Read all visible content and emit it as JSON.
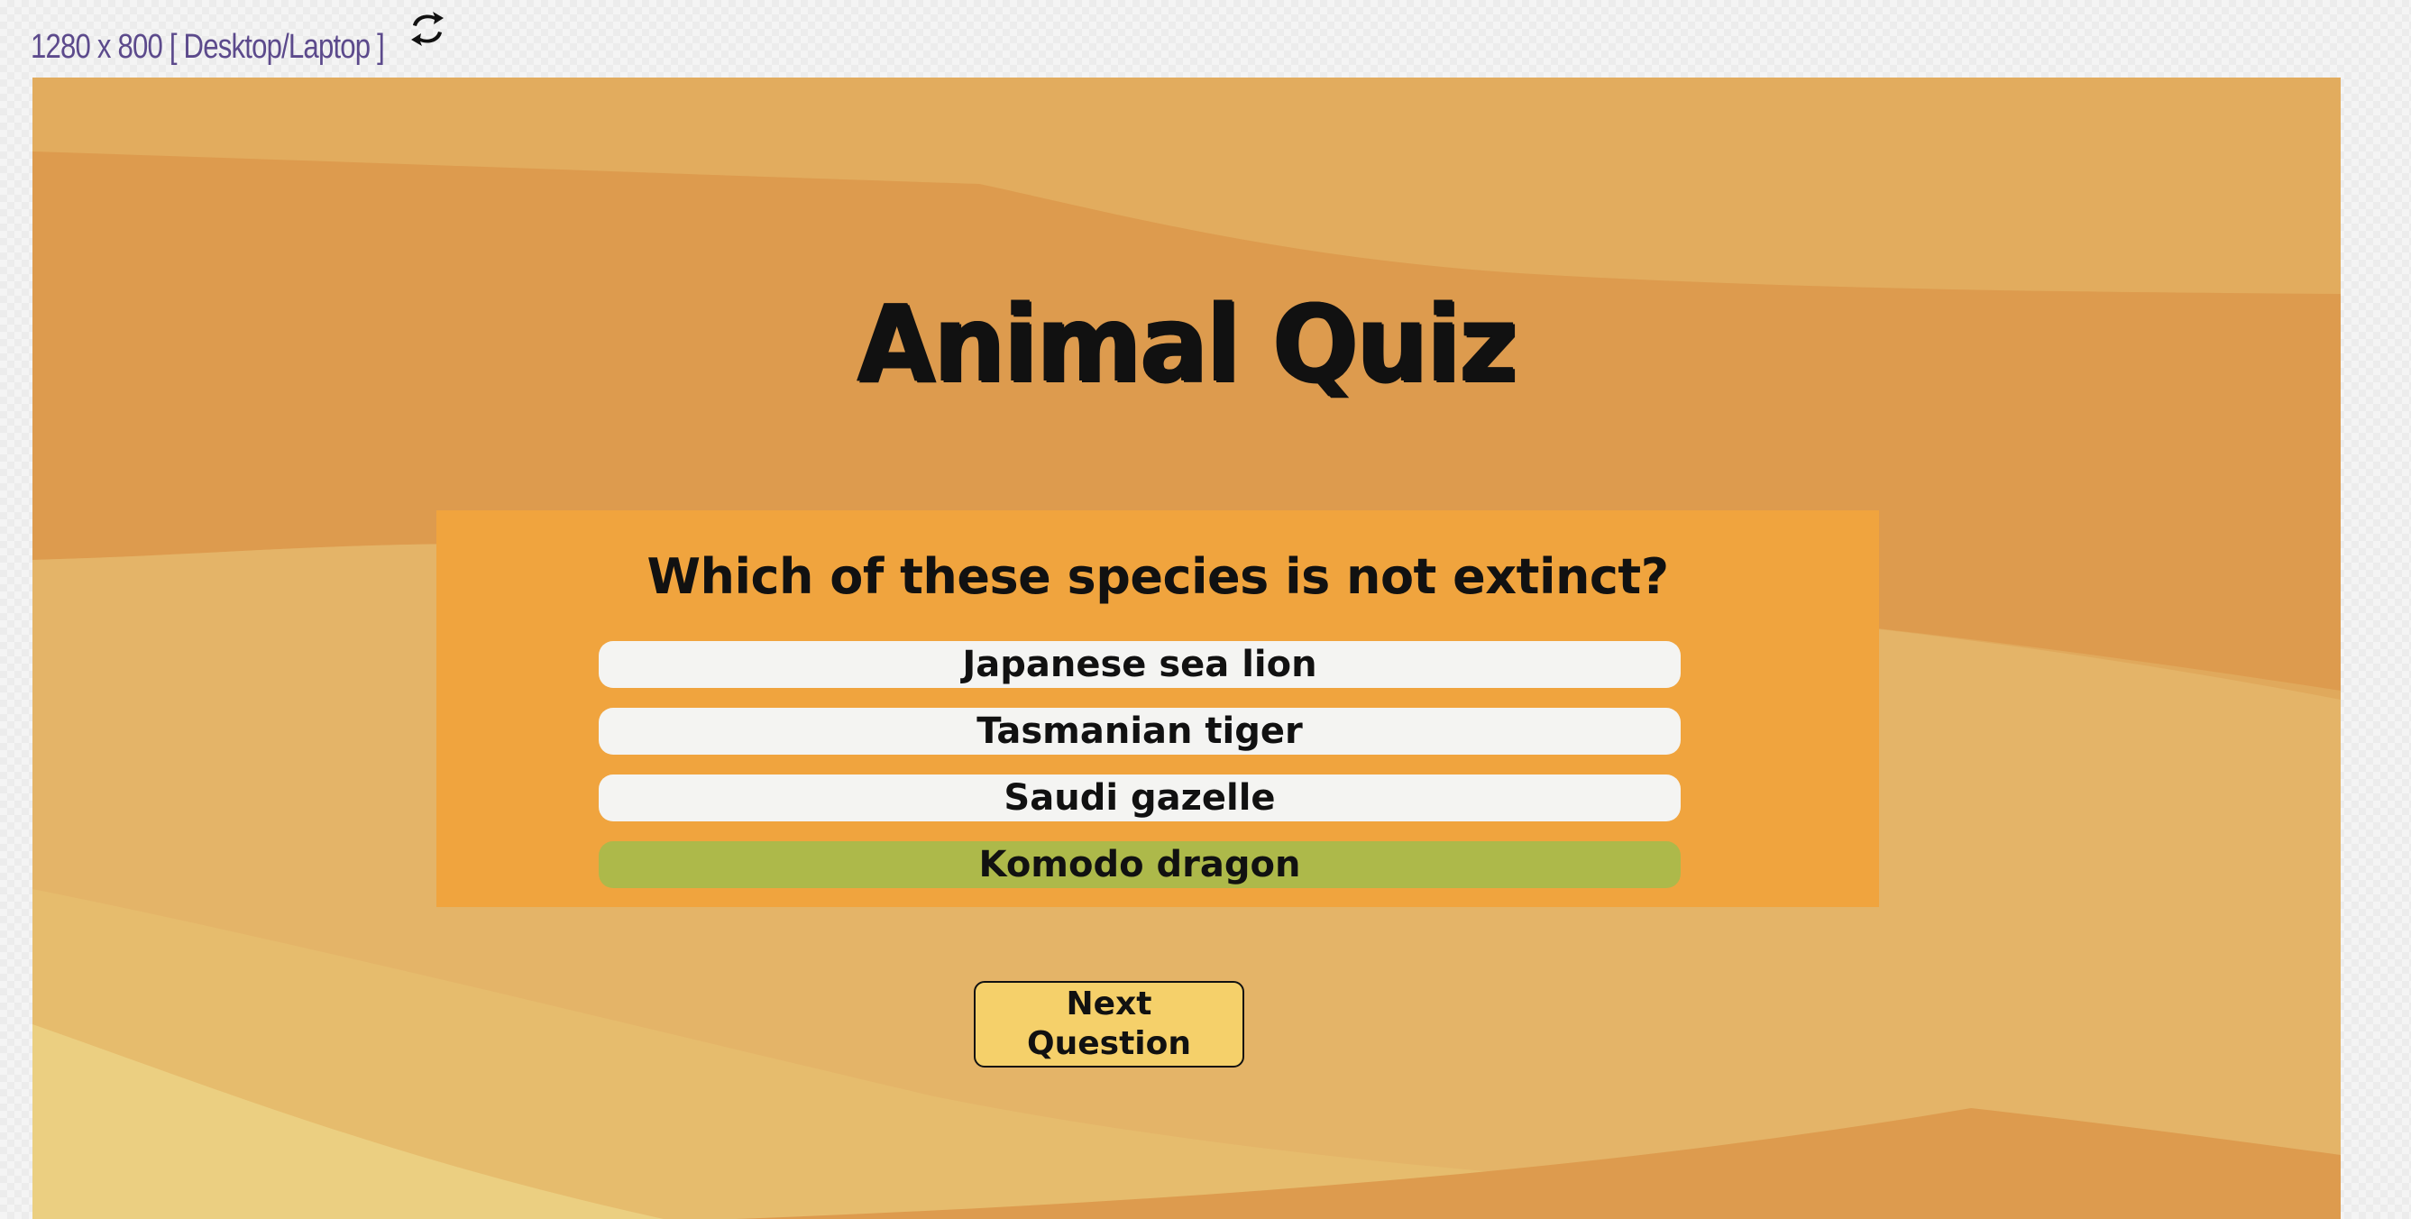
{
  "viewer": {
    "viewport_label": "1280 x 800 [ Desktop/Laptop ]",
    "rotate_icon": "rotate-icon"
  },
  "quiz": {
    "title": "Animal Quiz",
    "question": "Which of these species is not extinct?",
    "answers": [
      {
        "label": "Japanese sea lion",
        "state": "default"
      },
      {
        "label": "Tasmanian tiger",
        "state": "default"
      },
      {
        "label": "Saudi gazelle",
        "state": "default"
      },
      {
        "label": "Komodo dragon",
        "state": "correct"
      }
    ],
    "next_button_label": "Next\nQuestion"
  },
  "colors": {
    "background": "#e0a95c",
    "card": "#f0a43e",
    "answer_default": "#f4f4f2",
    "answer_correct": "#adb94a",
    "next_button": "#f5d06a",
    "viewport_label": "#5c4a8c"
  }
}
